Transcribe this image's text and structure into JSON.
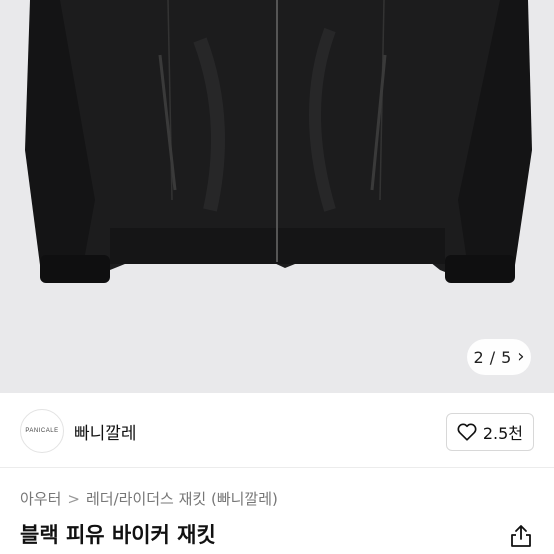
{
  "gallery": {
    "current": "2",
    "separator": "/",
    "total": "5",
    "next_icon": "chevron-right-icon"
  },
  "seller": {
    "avatar_text": "PANICALE",
    "name": "빠니깔레"
  },
  "like": {
    "icon": "heart-icon",
    "count": "2.5천"
  },
  "breadcrumb": {
    "category": "아우터",
    "separator": ">",
    "subcategory": "레더/라이더스 재킷 (빠니깔레)"
  },
  "product": {
    "title": "블랙 피유 바이커 재킷"
  },
  "share": {
    "icon": "share-icon"
  }
}
